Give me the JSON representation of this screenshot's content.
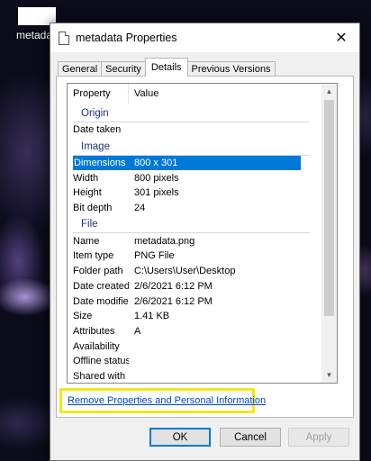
{
  "desktop": {
    "icon_label": "metada"
  },
  "dialog": {
    "title": "metadata Properties",
    "close_glyph": "✕",
    "tabs": [
      {
        "label": "General"
      },
      {
        "label": "Security"
      },
      {
        "label": "Details",
        "active": true
      },
      {
        "label": "Previous Versions"
      }
    ],
    "columns": {
      "property": "Property",
      "value": "Value"
    },
    "groups": {
      "origin": "Origin",
      "image": "Image",
      "file": "File"
    },
    "origin_rows": [
      {
        "key": "Date taken",
        "value": ""
      }
    ],
    "image_rows": [
      {
        "key": "Dimensions",
        "value": "800 x 301",
        "selected": true
      },
      {
        "key": "Width",
        "value": "800 pixels"
      },
      {
        "key": "Height",
        "value": "301 pixels"
      },
      {
        "key": "Bit depth",
        "value": "24"
      }
    ],
    "file_rows": [
      {
        "key": "Name",
        "value": "metadata.png"
      },
      {
        "key": "Item type",
        "value": "PNG File"
      },
      {
        "key": "Folder path",
        "value": "C:\\Users\\User\\Desktop"
      },
      {
        "key": "Date created",
        "value": "2/6/2021 6:12 PM"
      },
      {
        "key": "Date modified",
        "value": "2/6/2021 6:12 PM"
      },
      {
        "key": "Size",
        "value": "1.41 KB"
      },
      {
        "key": "Attributes",
        "value": "A"
      },
      {
        "key": "Availability",
        "value": ""
      },
      {
        "key": "Offline status",
        "value": ""
      },
      {
        "key": "Shared with",
        "value": ""
      }
    ],
    "link": "Remove Properties and Personal Information",
    "buttons": {
      "ok": "OK",
      "cancel": "Cancel",
      "apply": "Apply"
    },
    "scroll_up_glyph": "▲",
    "scroll_down_glyph": "▼",
    "highlight_color": "#f5e617",
    "selection_color": "#0078d7"
  }
}
